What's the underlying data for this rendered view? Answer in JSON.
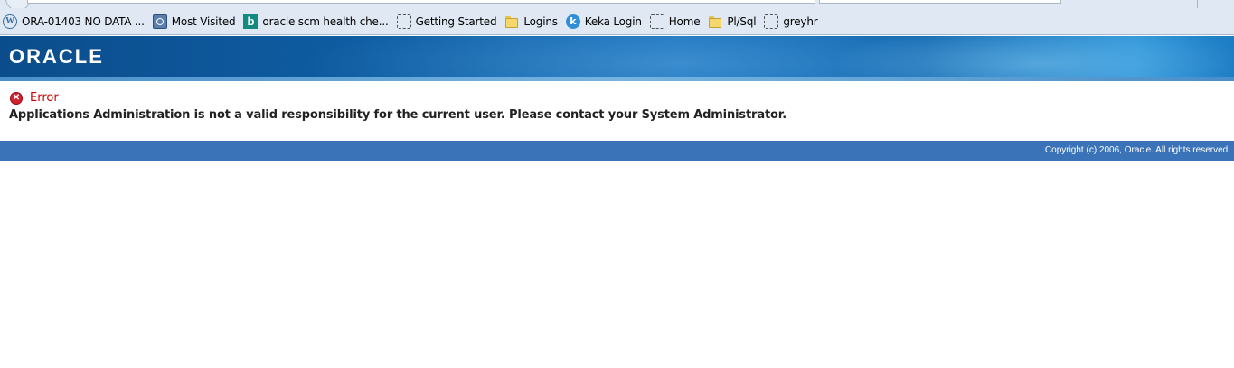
{
  "bookmarks": [
    {
      "label": "ORA-01403 NO DATA ...",
      "icon": "wordpress-icon"
    },
    {
      "label": "Most Visited",
      "icon": "most-visited-icon"
    },
    {
      "label": "oracle scm health che...",
      "icon": "bing-icon"
    },
    {
      "label": "Getting Started",
      "icon": "page-icon"
    },
    {
      "label": "Logins",
      "icon": "folder-icon"
    },
    {
      "label": "Keka Login",
      "icon": "keka-icon"
    },
    {
      "label": "Home",
      "icon": "page-icon"
    },
    {
      "label": "Pl/Sql",
      "icon": "folder-icon"
    },
    {
      "label": "greyhr",
      "icon": "page-icon"
    }
  ],
  "brand": {
    "logo_text": "ORACLE"
  },
  "error": {
    "label": "Error",
    "message": "Applications Administration is not a valid responsibility for the current user. Please contact your System Administrator."
  },
  "footer": {
    "copyright": "Copyright (c) 2006, Oracle. All rights reserved."
  },
  "colors": {
    "error_red": "#cc0000",
    "footer_blue": "#3b73b9",
    "brand_blue": "#0f5da3"
  }
}
